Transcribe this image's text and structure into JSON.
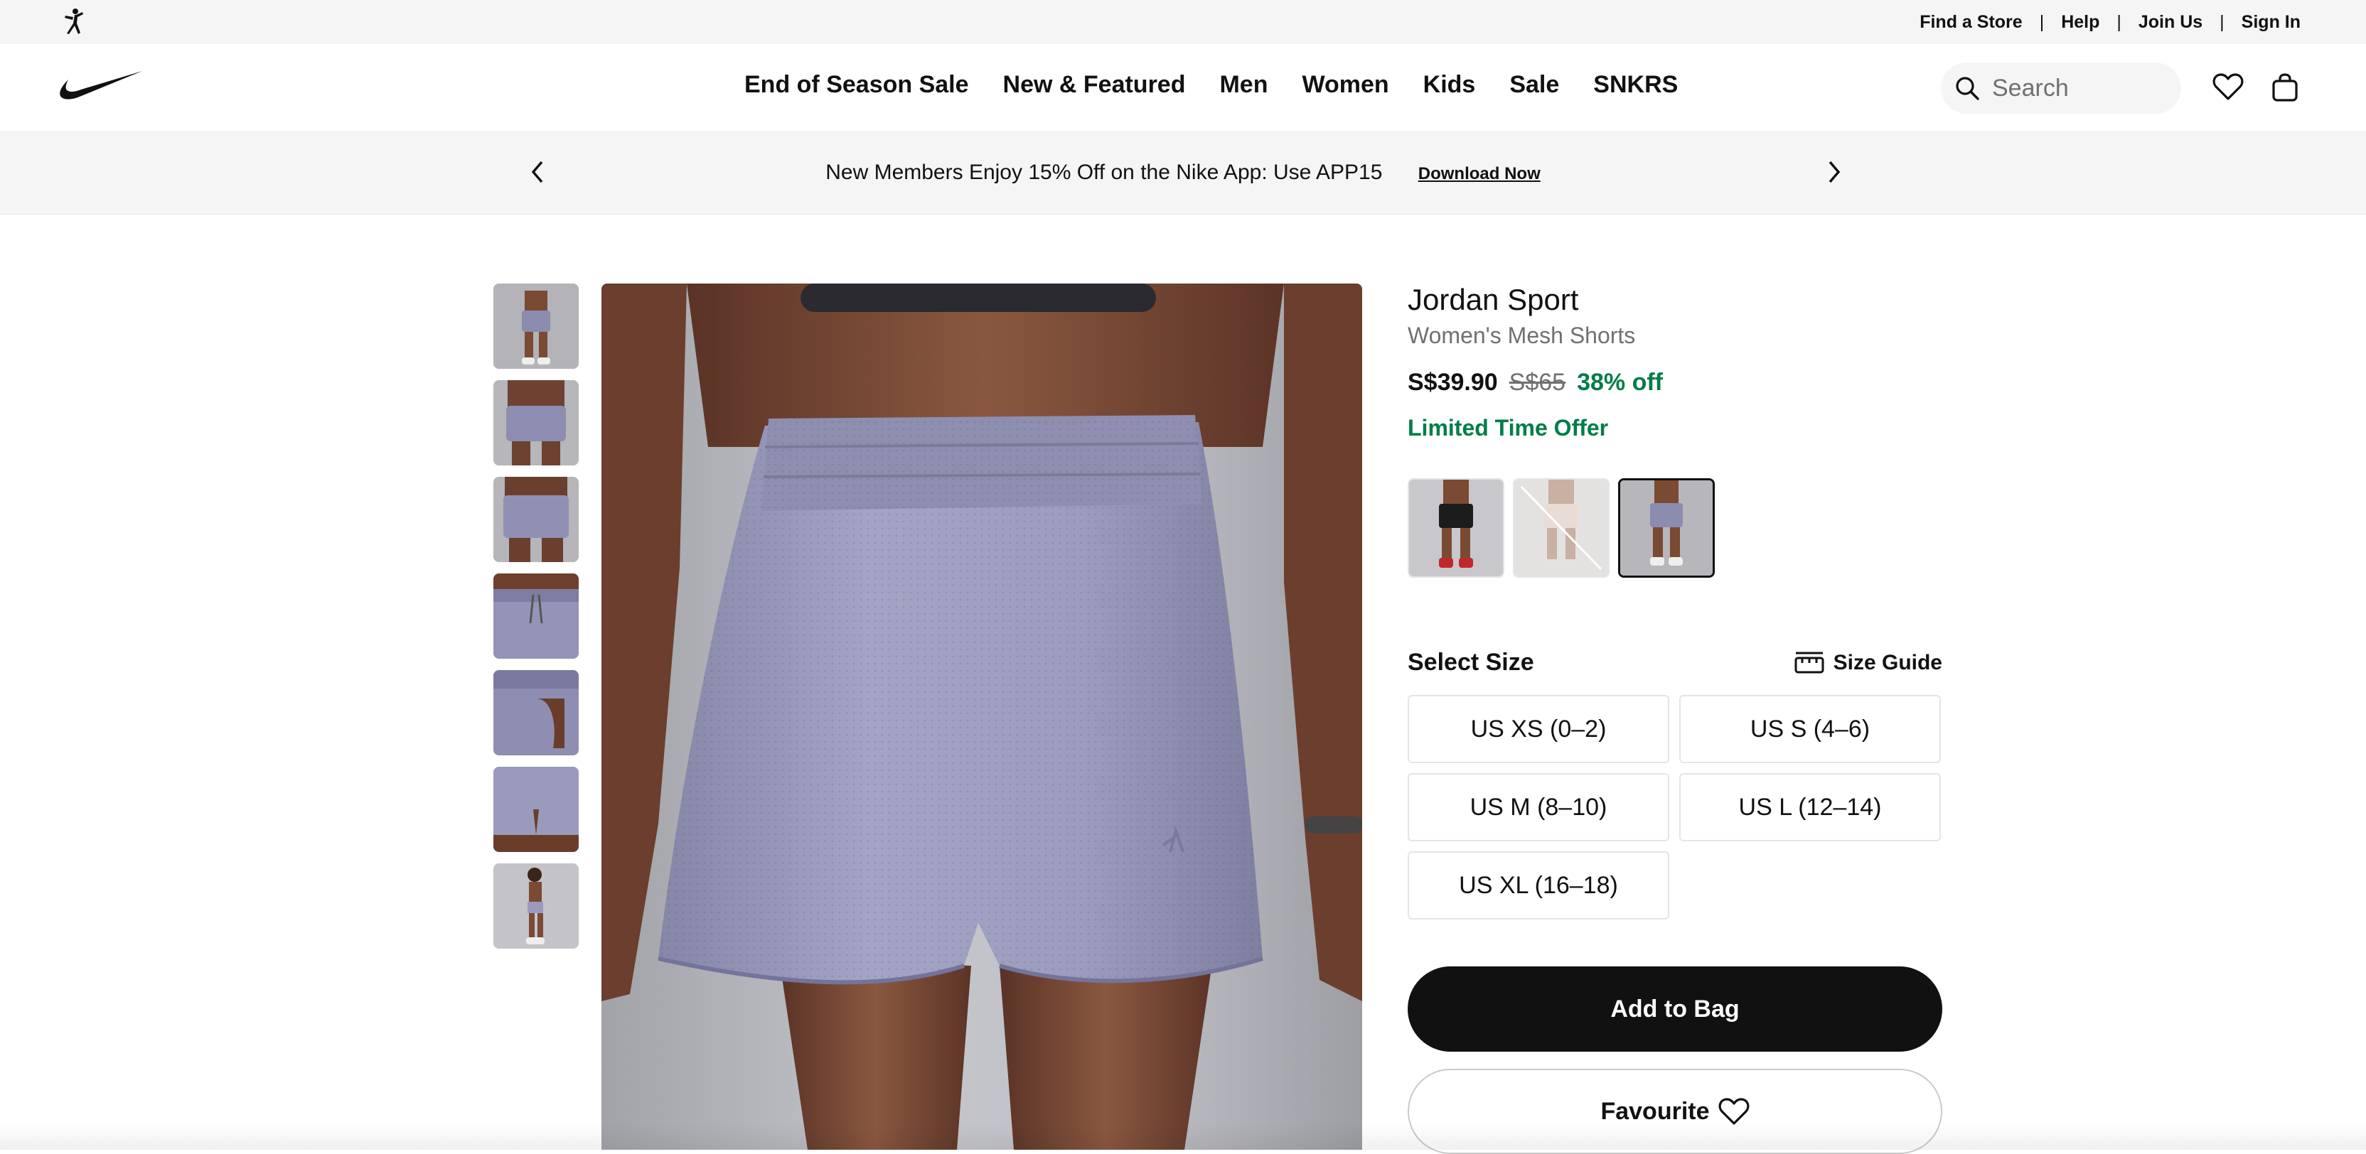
{
  "util_bar": {
    "links": [
      "Find a Store",
      "Help",
      "Join Us",
      "Sign In"
    ]
  },
  "nav": {
    "menu": [
      "End of Season Sale",
      "New & Featured",
      "Men",
      "Women",
      "Kids",
      "Sale",
      "SNKRS"
    ],
    "search_placeholder": "Search"
  },
  "promo": {
    "message": "New Members Enjoy 15% Off on the Nike App: Use APP15",
    "link": "Download Now"
  },
  "product": {
    "title": "Jordan Sport",
    "subtitle": "Women's Mesh Shorts",
    "price_current": "S$39.90",
    "price_original": "S$65",
    "discount": "38% off",
    "offer": "Limited Time Offer",
    "select_size_label": "Select Size",
    "size_guide_label": "Size Guide",
    "sizes": [
      "US XS (0–2)",
      "US S (4–6)",
      "US M (8–10)",
      "US L (12–14)",
      "US XL (16–18)"
    ],
    "add_to_bag": "Add to Bag",
    "favourite": "Favourite"
  },
  "colors": {
    "sale_green": "#007d48",
    "shorts_lilac": "#9c9cb8"
  },
  "icons": [
    "jordan-jumpman-icon",
    "nike-swoosh-icon",
    "search-icon",
    "heart-icon",
    "bag-icon",
    "chevron-left-icon",
    "chevron-right-icon",
    "ruler-icon"
  ]
}
